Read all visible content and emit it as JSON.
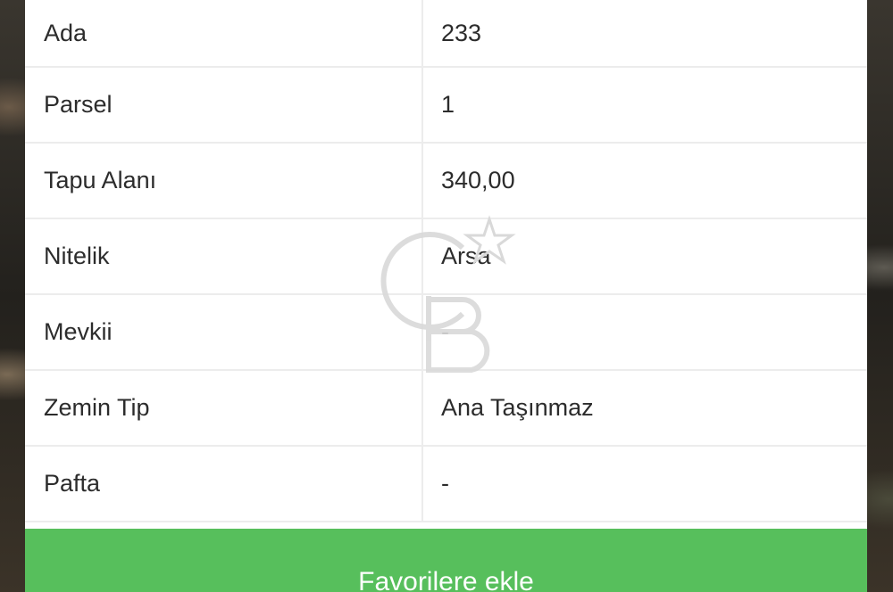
{
  "rows": [
    {
      "label": "Ada",
      "value": "233"
    },
    {
      "label": "Parsel",
      "value": "1"
    },
    {
      "label": "Tapu Alanı",
      "value": "340,00"
    },
    {
      "label": "Nitelik",
      "value": "Arsa"
    },
    {
      "label": "Mevkii",
      "value": "-"
    },
    {
      "label": "Zemin Tip",
      "value": "Ana Taşınmaz"
    },
    {
      "label": "Pafta",
      "value": "-"
    }
  ],
  "actions": {
    "favorite_label": "Favorilere ekle"
  },
  "colors": {
    "button_green": "#57bf5c",
    "watermark": "#e6e6e6"
  },
  "watermark": {
    "logo_text": "CB",
    "icon": "star-icon"
  }
}
